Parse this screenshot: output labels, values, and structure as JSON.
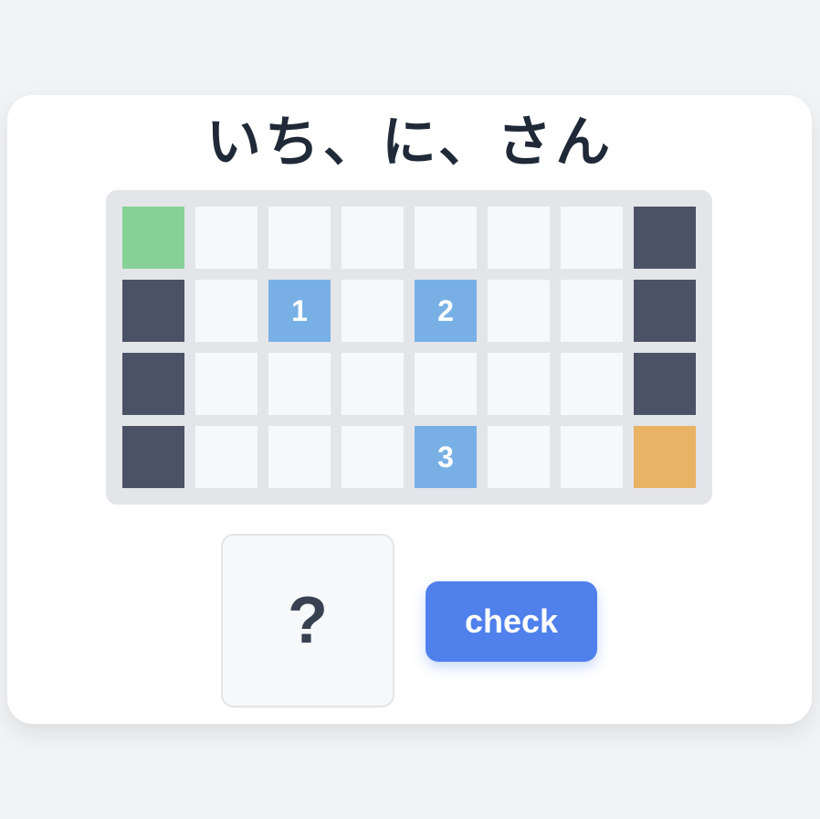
{
  "title": "いち、に、さん",
  "colors": {
    "background": "#f2f3f5",
    "card": "#ffffff",
    "board": "#e4e5e9",
    "empty": "#f7f8fa",
    "wall": "#4c5266",
    "start": "#86d196",
    "goal": "#eab264",
    "number": "#78b0e6",
    "button": "#5080ec"
  },
  "board": {
    "rows": 4,
    "cols": 8,
    "cells": [
      [
        "start",
        "empty",
        "empty",
        "empty",
        "empty",
        "empty",
        "empty",
        "wall"
      ],
      [
        "wall",
        "empty",
        "number",
        "empty",
        "number",
        "empty",
        "empty",
        "wall"
      ],
      [
        "wall",
        "empty",
        "empty",
        "empty",
        "empty",
        "empty",
        "empty",
        "wall"
      ],
      [
        "wall",
        "empty",
        "empty",
        "empty",
        "number",
        "empty",
        "empty",
        "goal"
      ]
    ],
    "labels": [
      [
        "",
        "",
        "",
        "",
        "",
        "",
        "",
        ""
      ],
      [
        "",
        "",
        "1",
        "",
        "2",
        "",
        "",
        ""
      ],
      [
        "",
        "",
        "",
        "",
        "",
        "",
        "",
        ""
      ],
      [
        "",
        "",
        "",
        "",
        "3",
        "",
        "",
        ""
      ]
    ]
  },
  "answer": {
    "value": "?"
  },
  "check_label": "check"
}
